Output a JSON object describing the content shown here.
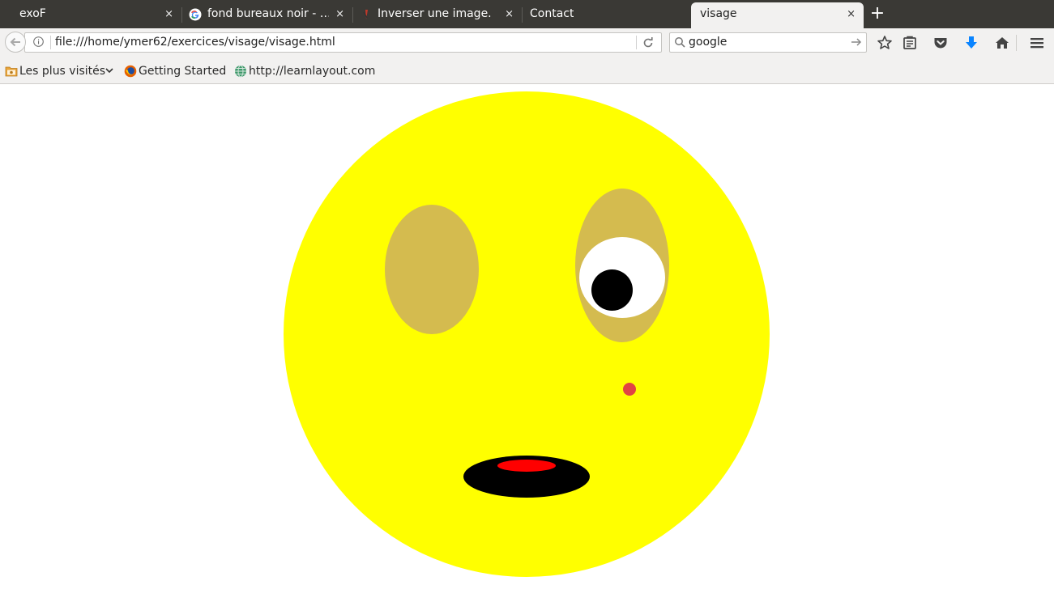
{
  "browser": {
    "tabs": [
      {
        "title": "exoF",
        "favicon": "none",
        "active": false
      },
      {
        "title": "fond bureaux noir - …",
        "favicon": "google-icon",
        "active": false
      },
      {
        "title": "Inverser une image.",
        "favicon": "wikipedia-style-icon",
        "active": false
      },
      {
        "title": "Contact",
        "favicon": "none",
        "active": false
      },
      {
        "title": "visage",
        "favicon": "none",
        "active": true
      }
    ],
    "new_tab_symbol": "+",
    "close_symbol": "×",
    "url": "file:///home/ymer62/exercices/visage/visage.html",
    "search": {
      "value": "google",
      "engine_icon": "search-icon"
    },
    "toolbar_icons": [
      "star-icon",
      "reading-list-icon",
      "pocket-icon",
      "download-icon",
      "home-icon",
      "menu-icon"
    ],
    "bookmarks": [
      {
        "label": "Les plus visités",
        "icon": "folder-icon",
        "has_dropdown": true
      },
      {
        "label": "Getting Started",
        "icon": "firefox-icon",
        "has_dropdown": false
      },
      {
        "label": "http://learnlayout.com",
        "icon": "globe-icon",
        "has_dropdown": false
      }
    ]
  },
  "page": {
    "colors": {
      "face": "#ffff00",
      "eye_socket": "#d4bb4f",
      "eye_white": "#ffffff",
      "pupil": "#000000",
      "mole": "#e04444",
      "mouth": "#000000",
      "tongue": "#ff0000",
      "tab_strip": "#3a3935",
      "toolbar": "#f2f1f0",
      "download_accent": "#0a84ff"
    }
  }
}
